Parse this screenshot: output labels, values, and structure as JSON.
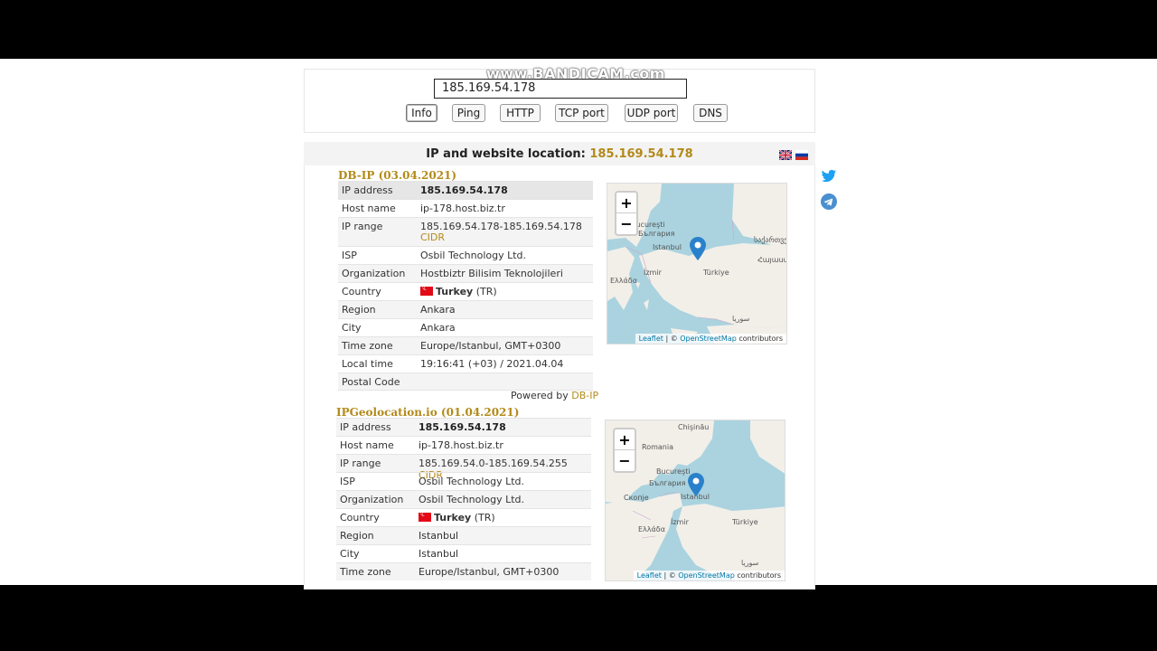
{
  "watermark": "www.BANDICAM.com",
  "search": {
    "value": "185.169.54.178"
  },
  "tools": [
    {
      "label": "Info",
      "active": true
    },
    {
      "label": "Ping"
    },
    {
      "label": "HTTP"
    },
    {
      "label": "TCP port"
    },
    {
      "label": "UDP port"
    },
    {
      "label": "DNS"
    }
  ],
  "heading": {
    "prefix": "IP and website location: ",
    "ip": "185.169.54.178"
  },
  "dbip": {
    "title": "DB-IP (03.04.2021)",
    "rows": [
      {
        "key": "IP address",
        "value": "185.169.54.178"
      },
      {
        "key": "Host name",
        "value": "ip-178.host.biz.tr"
      },
      {
        "key": "IP range",
        "value": "185.169.54.178-185.169.54.178",
        "extra": "CIDR"
      },
      {
        "key": "ISP",
        "value": "Osbil Technology Ltd."
      },
      {
        "key": "Organization",
        "value": "Hostbiztr Bilisim Teknolojileri"
      },
      {
        "key": "Country",
        "value": "Turkey",
        "extra": "(TR)"
      },
      {
        "key": "Region",
        "value": "Ankara"
      },
      {
        "key": "City",
        "value": "Ankara"
      },
      {
        "key": "Time zone",
        "value": "Europe/Istanbul, GMT+0300"
      },
      {
        "key": "Local time",
        "value": "19:16:41 (+03) / 2021.04.04"
      },
      {
        "key": "Postal Code",
        "value": ""
      }
    ],
    "powered_prefix": "Powered by ",
    "powered_link": "DB-IP"
  },
  "ipgeo": {
    "title": "IPGeolocation.io (01.04.2021)",
    "rows": [
      {
        "key": "IP address",
        "value": "185.169.54.178"
      },
      {
        "key": "Host name",
        "value": "ip-178.host.biz.tr"
      },
      {
        "key": "IP range",
        "value": "185.169.54.0-185.169.54.255",
        "extra": "CIDR"
      },
      {
        "key": "ISP",
        "value": "Osbil Technology Ltd."
      },
      {
        "key": "Organization",
        "value": "Osbil Technology Ltd."
      },
      {
        "key": "Country",
        "value": "Turkey",
        "extra": "(TR)"
      },
      {
        "key": "Region",
        "value": "Istanbul"
      },
      {
        "key": "City",
        "value": "Istanbul"
      },
      {
        "key": "Time zone",
        "value": "Europe/Istanbul, GMT+0300"
      }
    ]
  },
  "map": {
    "zoom_in": "+",
    "zoom_out": "−",
    "attrib_leaflet": "Leaflet",
    "attrib_sep": " | © ",
    "attrib_osm": "OpenStreetMap",
    "attrib_suffix": " contributors",
    "labels1": [
      "Bucureşti",
      "България",
      "Istanbul",
      "İzmir",
      "Türkiye",
      "Ελλάδα",
      "საქართველო",
      "Հայաստան",
      "سوريا"
    ],
    "labels2": [
      "Chişinău",
      "Romania",
      "Bucureşti",
      "България",
      "Скопје",
      "Istanbul",
      "İzmir",
      "Türkiye",
      "Ελλάδα",
      "سوريا"
    ]
  }
}
